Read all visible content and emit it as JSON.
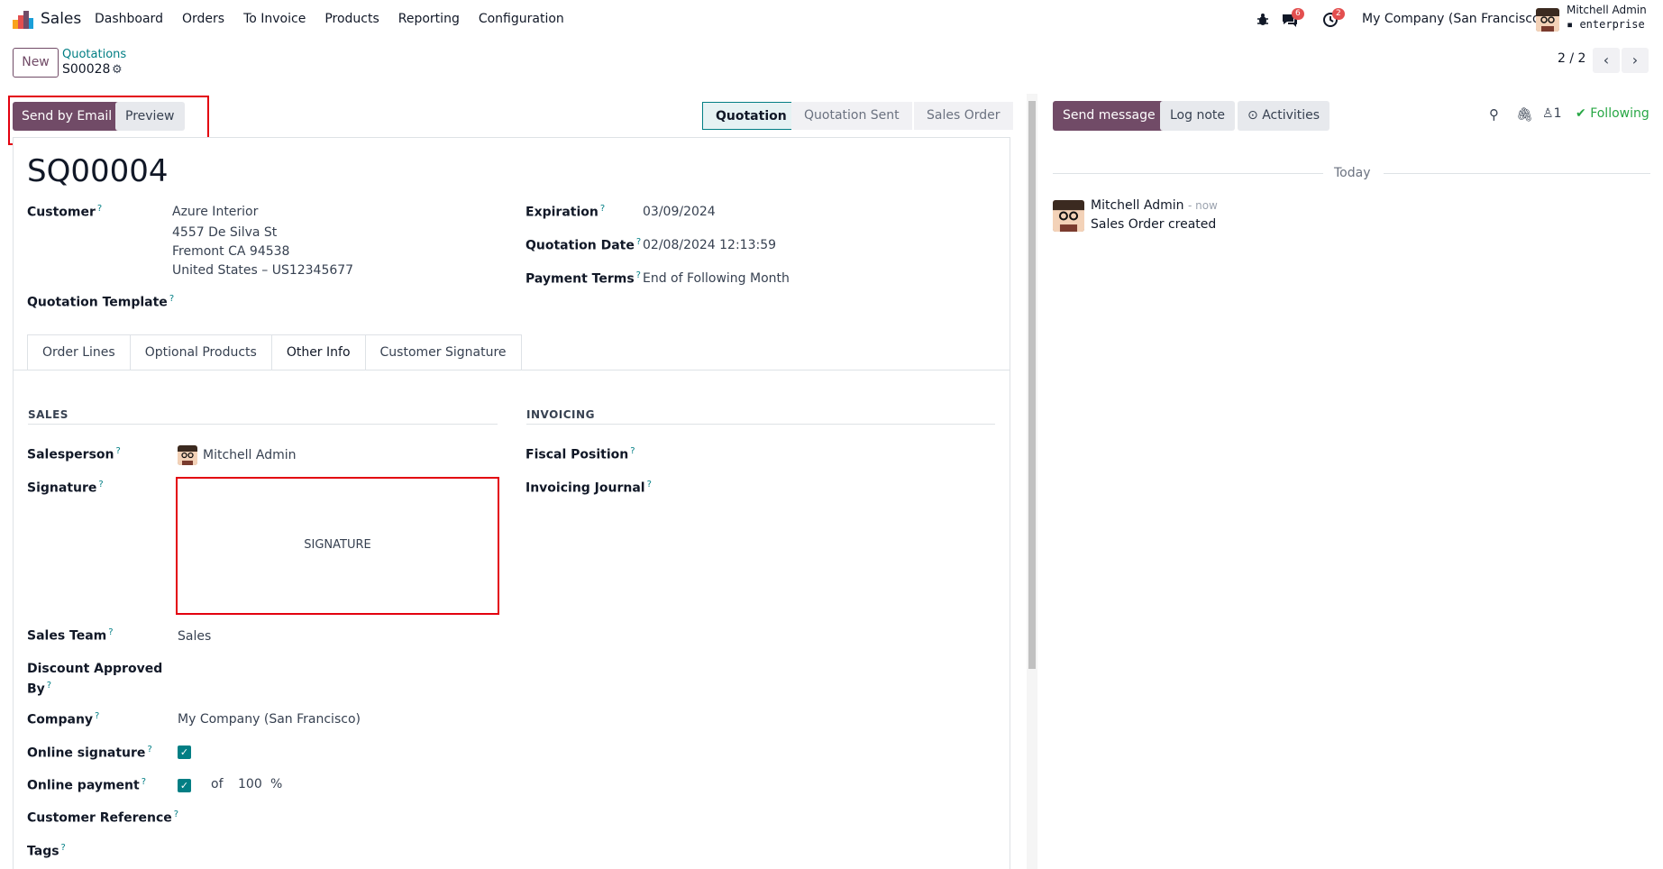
{
  "navbar": {
    "app_name": "Sales",
    "menu": [
      "Dashboard",
      "Orders",
      "To Invoice",
      "Products",
      "Reporting",
      "Configuration"
    ],
    "messages_count": "6",
    "activities_count": "2",
    "company": "My Company (San Francisco)",
    "user_name": "Mitchell Admin",
    "database": "enterprise"
  },
  "control_panel": {
    "new_label": "New",
    "breadcrumb_parent": "Quotations",
    "breadcrumb_current": "S00028",
    "pager": "2 / 2"
  },
  "statusbar": {
    "send_email": "Send by Email",
    "preview": "Preview",
    "stages": [
      "Quotation",
      "Quotation Sent",
      "Sales Order"
    ],
    "active_stage": "Quotation"
  },
  "record": {
    "title": "SQ00004",
    "customer_label": "Customer",
    "customer_name": "Azure Interior",
    "customer_street": "4557 De Silva St",
    "customer_city": "Fremont CA 94538",
    "customer_country": "United States – US12345677",
    "template_label": "Quotation Template",
    "expiration_label": "Expiration",
    "expiration_value": "03/09/2024",
    "quotation_date_label": "Quotation Date",
    "quotation_date_value": "02/08/2024 12:13:59",
    "payment_terms_label": "Payment Terms",
    "payment_terms_value": "End of Following Month"
  },
  "tabs": [
    "Order Lines",
    "Optional Products",
    "Other Info",
    "Customer Signature"
  ],
  "other_info": {
    "sales_title": "SALES",
    "invoicing_title": "INVOICING",
    "salesperson_label": "Salesperson",
    "salesperson_value": "Mitchell Admin",
    "signature_label": "Signature",
    "signature_placeholder": "SIGNATURE",
    "sales_team_label": "Sales Team",
    "sales_team_value": "Sales",
    "discount_label_1": "Discount Approved",
    "discount_label_2": "By",
    "company_label": "Company",
    "company_value": "My Company (San Francisco)",
    "online_signature_label": "Online signature",
    "online_payment_label": "Online payment",
    "online_payment_of": "of",
    "online_payment_value": "100",
    "online_payment_unit": "%",
    "customer_reference_label": "Customer Reference",
    "tags_label": "Tags",
    "fiscal_position_label": "Fiscal Position",
    "invoicing_journal_label": "Invoicing Journal"
  },
  "chatter": {
    "send_message": "Send message",
    "log_note": "Log note",
    "activities": "Activities",
    "followers_count": "1",
    "following": "Following",
    "today": "Today",
    "author": "Mitchell Admin",
    "time": "- now",
    "body": "Sales Order created"
  },
  "colors": {
    "brand": "#714b67",
    "accent": "#017e84",
    "highlight": "#e3000f",
    "success": "#28a745"
  }
}
